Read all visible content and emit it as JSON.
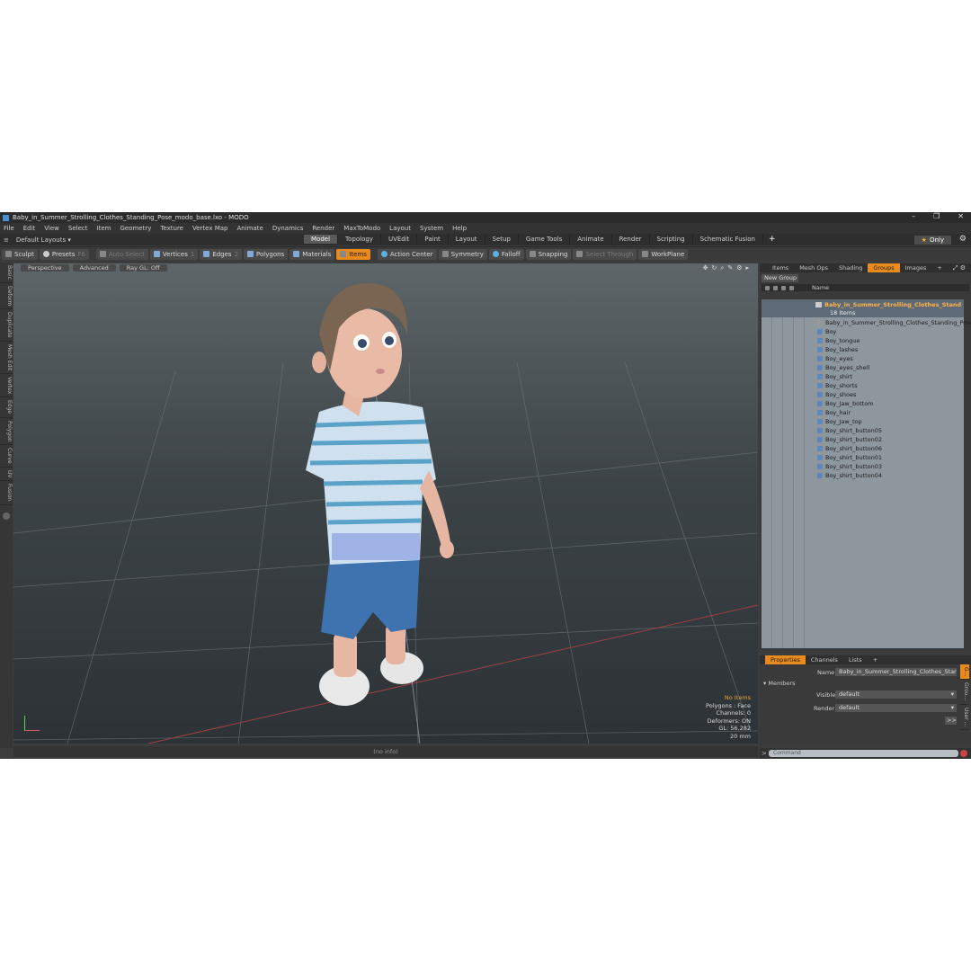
{
  "window": {
    "title": "Baby_in_Summer_Strolling_Clothes_Standing_Pose_modo_base.lxo - MODO",
    "controls": [
      "–",
      "❐",
      "✕"
    ]
  },
  "menu": [
    "File",
    "Edit",
    "View",
    "Select",
    "Item",
    "Geometry",
    "Texture",
    "Vertex Map",
    "Animate",
    "Dynamics",
    "Render",
    "MaxToModo",
    "Layout",
    "System",
    "Help"
  ],
  "layout": {
    "selector": "Default Layouts ▾",
    "tabs": [
      "Model",
      "Topology",
      "UVEdit",
      "Paint",
      "Layout",
      "Setup",
      "Game Tools",
      "Animate",
      "Render",
      "Scripting",
      "Schematic Fusion"
    ],
    "active_tab": "Model",
    "add_tab": "+",
    "only_label": "Only"
  },
  "toolbar": {
    "sculpt": "Sculpt",
    "presets": "Presets",
    "presets_key": "F6",
    "auto_select": "Auto Select",
    "vertices": "Vertices",
    "vertices_key": "1",
    "edges": "Edges",
    "edges_key": "2",
    "polygons": "Polygons",
    "materials": "Materials",
    "items": "Items",
    "action_center": "Action Center",
    "symmetry": "Symmetry",
    "falloff": "Falloff",
    "snapping": "Snapping",
    "select_through": "Select Through",
    "workplane": "WorkPlane"
  },
  "side_tabs": [
    "Basic",
    "Deform",
    "Duplicate",
    "Mesh Edit",
    "Vertex",
    "Edge",
    "Polygon",
    "Curve",
    "UV",
    "Fusion"
  ],
  "viewport": {
    "view_mode": "Perspective",
    "shading": "Advanced",
    "raygl": "Ray GL: Off",
    "hud": {
      "items": "No Items",
      "polygons": "Polygons : Face",
      "channels": "Channels: 0",
      "deformers": "Deformers: ON",
      "gl": "GL: 56,282",
      "scale": "20 mm"
    },
    "status": "(no info)"
  },
  "right_panel": {
    "tabs": [
      "Items",
      "Mesh Ops",
      "Shading",
      "Groups",
      "Images"
    ],
    "active_tab": "Groups",
    "add_tab": "+",
    "new_group": "New Group",
    "name_header": "Name",
    "group_name": "Baby_in_Summer_Strolling_Clothes_Standing...",
    "group_count": "18 Items",
    "items": [
      "Baby_in_Summer_Strolling_Clothes_Standing_Pose",
      "Boy",
      "Boy_tongue",
      "Boy_lashes",
      "Boy_eyes",
      "Boy_eyes_shell",
      "Boy_shirt",
      "Boy_shorts",
      "Boy_shoes",
      "Boy_Jaw_bottom",
      "Boy_hair",
      "Boy_Jaw_top",
      "Boy_shirt_button05",
      "Boy_shirt_button02",
      "Boy_shirt_button06",
      "Boy_shirt_button01",
      "Boy_shirt_button03",
      "Boy_shirt_button04"
    ]
  },
  "properties": {
    "tabs": [
      "Properties",
      "Channels",
      "Lists"
    ],
    "active_tab": "Properties",
    "add_tab": "+",
    "name_label": "Name",
    "name_value": "Baby_in_Summer_Strolling_Clothes_Standing_P",
    "members": "Members",
    "visible_label": "Visible",
    "visible_value": "default",
    "render_label": "Render",
    "render_value": "default",
    "expand": ">>",
    "side_tabs": [
      "G...",
      "Grou...",
      "User ..."
    ]
  },
  "command": {
    "prompt": ">",
    "placeholder": "Command"
  },
  "colors": {
    "accent": "#e88a1c",
    "group_name": "#ffb347",
    "panel_bg": "#3a3a3a",
    "tree_bg": "#8e969e"
  }
}
